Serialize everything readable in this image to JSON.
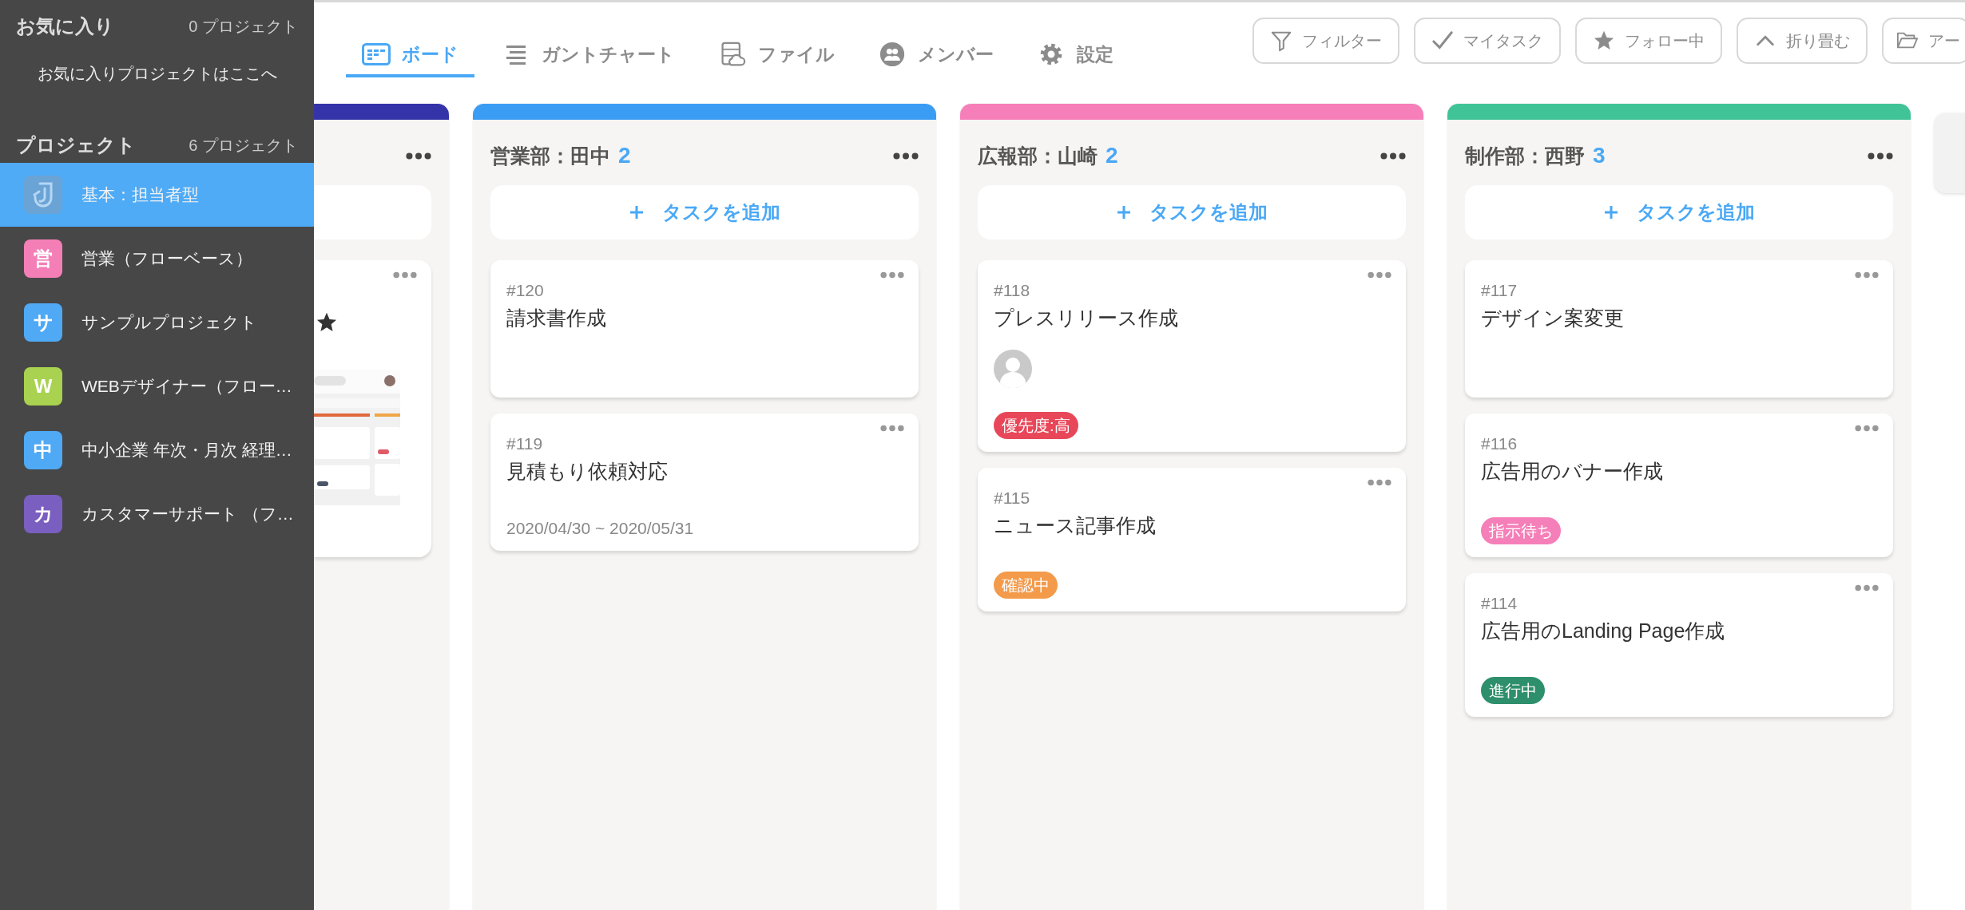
{
  "sidebar": {
    "favorites": {
      "title": "お気に入り",
      "count": "0 プロジェクト",
      "empty_text": "お気に入りプロジェクトはここへ"
    },
    "projects": {
      "title": "プロジェクト",
      "count": "6 プロジェクト",
      "items": [
        {
          "kind": "logo",
          "name": "基本：担当者型",
          "selected": true
        },
        {
          "kind": "letter",
          "letter": "営",
          "color": "#f47fb6",
          "name": "営業（フローベース）",
          "selected": false
        },
        {
          "kind": "letter",
          "letter": "サ",
          "color": "#4fa9f5",
          "name": "サンプルプロジェクト",
          "selected": false
        },
        {
          "kind": "letter",
          "letter": "W",
          "color": "#a8d24f",
          "name": "WEBデザイナー（フロー…",
          "selected": false
        },
        {
          "kind": "letter",
          "letter": "中",
          "color": "#4fa9f5",
          "name": "中小企業 年次・月次 経理…",
          "selected": false
        },
        {
          "kind": "letter",
          "letter": "カ",
          "color": "#7a5ec0",
          "name": "カスタマーサポート （フ…",
          "selected": false
        }
      ]
    }
  },
  "tabs": [
    {
      "kind": "board",
      "label": "ボード",
      "selected": true
    },
    {
      "kind": "gantt",
      "label": "ガントチャート",
      "selected": false
    },
    {
      "kind": "files",
      "label": "ファイル",
      "selected": false
    },
    {
      "kind": "members",
      "label": "メンバー",
      "selected": false
    },
    {
      "kind": "settings",
      "label": "設定",
      "selected": false
    }
  ],
  "toolbar_buttons": [
    {
      "kind": "filter",
      "label": "フィルター"
    },
    {
      "kind": "check",
      "label": "マイタスク"
    },
    {
      "kind": "star",
      "label": "フォロー中"
    },
    {
      "kind": "collapse",
      "label": "折り畳む"
    },
    {
      "kind": "folder",
      "label": "アー"
    }
  ],
  "board": {
    "columns": [
      {
        "kind": "partial",
        "color": "#3434a8"
      },
      {
        "kind": "full",
        "color": "#3b9cf4",
        "title": "営業部：田中",
        "count": "2",
        "add_label": "タスクを追加",
        "cards": [
          {
            "kind": "task",
            "number": "#120",
            "title": "請求書作成"
          },
          {
            "kind": "task",
            "number": "#119",
            "title": "見積もり依頼対応",
            "dates": "2020/04/30 ~ 2020/05/31"
          }
        ]
      },
      {
        "kind": "full",
        "color": "#f67fb9",
        "title": "広報部：山崎",
        "count": "2",
        "add_label": "タスクを追加",
        "cards": [
          {
            "kind": "task",
            "number": "#118",
            "title": "プレスリリース作成",
            "avatar": true,
            "tag": {
              "label": "優先度:高",
              "color": "#e8475a"
            }
          },
          {
            "kind": "task",
            "number": "#115",
            "title": "ニュース記事作成",
            "tag": {
              "label": "確認中",
              "color": "#f39a4b"
            }
          }
        ]
      },
      {
        "kind": "full",
        "color": "#40c397",
        "title": "制作部：西野",
        "count": "3",
        "add_label": "タスクを追加",
        "cards": [
          {
            "kind": "task",
            "number": "#117",
            "title": "デザイン案変更"
          },
          {
            "kind": "task",
            "number": "#116",
            "title": "広告用のバナー作成",
            "tag": {
              "label": "指示待ち",
              "color": "#f57fb8"
            }
          },
          {
            "kind": "task",
            "number": "#114",
            "title": "広告用のLanding Page作成",
            "tag": {
              "label": "進行中",
              "color": "#2e8f6c"
            }
          }
        ]
      }
    ]
  }
}
